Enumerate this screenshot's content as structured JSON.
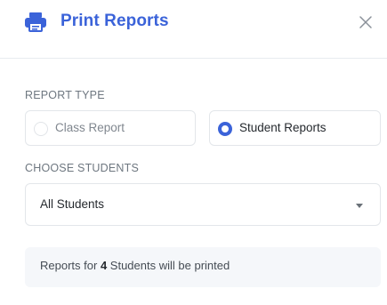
{
  "header": {
    "title": "Print Reports",
    "icon": "printer-icon",
    "close_icon": "close-icon",
    "accent_color": "#3b63d9"
  },
  "report_type": {
    "label": "REPORT TYPE",
    "options": [
      {
        "label": "Class Report",
        "selected": false
      },
      {
        "label": "Student Reports",
        "selected": true
      }
    ]
  },
  "choose_students": {
    "label": "CHOOSE STUDENTS",
    "selected_value": "All Students",
    "dropdown_icon": "caret-down-icon"
  },
  "summary": {
    "prefix": "Reports for",
    "count": "4",
    "suffix": "Students will be printed"
  }
}
